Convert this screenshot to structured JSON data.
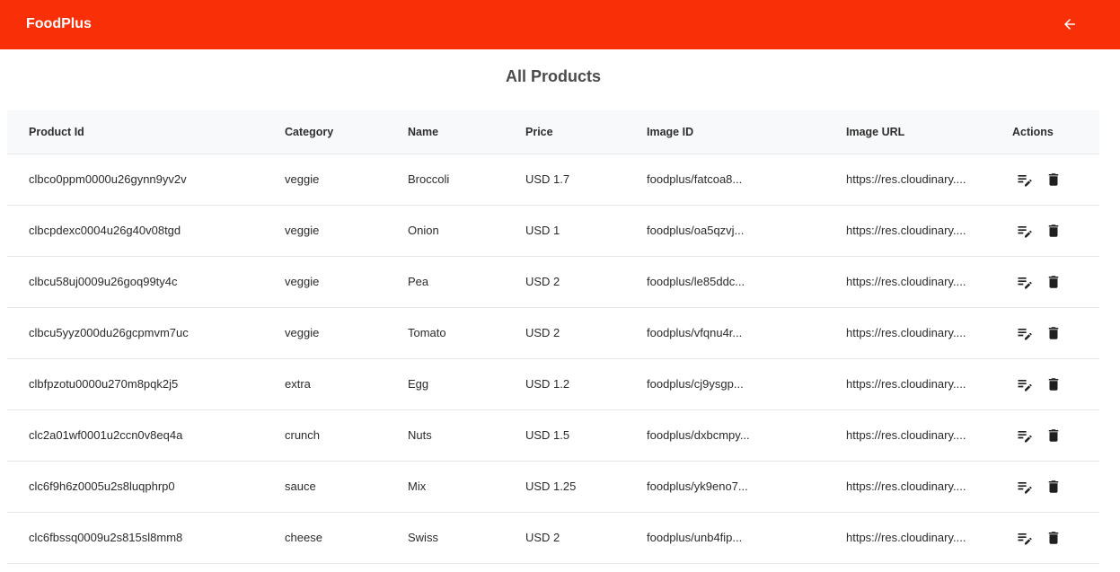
{
  "app": {
    "brand": "FoodPlus",
    "header_color": "#f92f07"
  },
  "header": {
    "back_icon": "arrow-left-icon"
  },
  "page": {
    "title": "All Products"
  },
  "table": {
    "columns": [
      "Product Id",
      "Category",
      "Name",
      "Price",
      "Image ID",
      "Image URL",
      "Actions"
    ],
    "rows": [
      {
        "id": "clbco0ppm0000u26gynn9yv2v",
        "category": "veggie",
        "name": "Broccoli",
        "price": "USD 1.7",
        "image_id": "foodplus/fatcoa8...",
        "image_url": "https://res.cloudinary...."
      },
      {
        "id": "clbcpdexc0004u26g40v08tgd",
        "category": "veggie",
        "name": "Onion",
        "price": "USD 1",
        "image_id": "foodplus/oa5qzvj...",
        "image_url": "https://res.cloudinary...."
      },
      {
        "id": "clbcu58uj0009u26goq99ty4c",
        "category": "veggie",
        "name": "Pea",
        "price": "USD 2",
        "image_id": "foodplus/le85ddc...",
        "image_url": "https://res.cloudinary...."
      },
      {
        "id": "clbcu5yyz000du26gcpmvm7uc",
        "category": "veggie",
        "name": "Tomato",
        "price": "USD 2",
        "image_id": "foodplus/vfqnu4r...",
        "image_url": "https://res.cloudinary...."
      },
      {
        "id": "clbfpzotu0000u270m8pqk2j5",
        "category": "extra",
        "name": "Egg",
        "price": "USD 1.2",
        "image_id": "foodplus/cj9ysgp...",
        "image_url": "https://res.cloudinary...."
      },
      {
        "id": "clc2a01wf0001u2ccn0v8eq4a",
        "category": "crunch",
        "name": "Nuts",
        "price": "USD 1.5",
        "image_id": "foodplus/dxbcmpy...",
        "image_url": "https://res.cloudinary...."
      },
      {
        "id": "clc6f9h6z0005u2s8luqphrp0",
        "category": "sauce",
        "name": "Mix",
        "price": "USD 1.25",
        "image_id": "foodplus/yk9eno7...",
        "image_url": "https://res.cloudinary...."
      },
      {
        "id": "clc6fbssq0009u2s815sl8mm8",
        "category": "cheese",
        "name": "Swiss",
        "price": "USD 2",
        "image_id": "foodplus/unb4fip...",
        "image_url": "https://res.cloudinary...."
      }
    ],
    "row_actions": [
      "edit-icon",
      "delete-icon"
    ]
  }
}
